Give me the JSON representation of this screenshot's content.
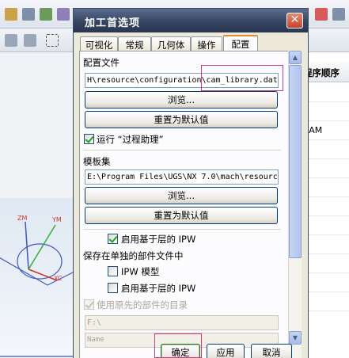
{
  "dialog": {
    "title": "加工首选项",
    "close_glyph": "✕",
    "tabs": [
      {
        "label": "可视化"
      },
      {
        "label": "常规"
      },
      {
        "label": "几何体"
      },
      {
        "label": "操作"
      },
      {
        "label": "配置",
        "active": true
      }
    ],
    "config_file": {
      "label": "配置文件",
      "value": "H\\resource\\configuration\\cam_library.dat",
      "browse_label": "浏览...",
      "reset_label": "重置为默认值"
    },
    "run_assistant": {
      "label": "运行 “过程助理”",
      "checked": true
    },
    "template_set": {
      "label": "模板集",
      "value": "E:\\Program Files\\UGS\\NX 7.0\\mach\\resourc",
      "browse_label": "浏览...",
      "reset_label": "重置为默认值"
    },
    "layer_ipw": {
      "label": "启用基于层的 IPW",
      "checked": true
    },
    "save_separate": {
      "label": "保存在单独的部件文件中"
    },
    "ipw_model": {
      "label": "IPW 模型",
      "checked": false
    },
    "layer_ipw2": {
      "label": "启用基于层的 IPW",
      "checked": false
    },
    "use_original_dir": {
      "label": "使用原先的部件的目录",
      "checked": true,
      "disabled": true
    },
    "dir_field": {
      "value": "F:\\"
    },
    "name_field": {
      "value": "Name"
    },
    "footer": {
      "ok_label": "确定",
      "apply_label": "应用",
      "cancel_label": "取消"
    },
    "scroll": {
      "up_glyph": "▲",
      "down_glyph": "▼"
    }
  },
  "background": {
    "right_header": "程序顺序",
    "right_row_text": "RAM",
    "axis_labels": [
      "ZM",
      "YM",
      "XC"
    ]
  },
  "colors": {
    "titlebar": "#33425f",
    "highlight": "#d03a86",
    "close_button": "#c8432a",
    "active_tab_accent": "#e68b2c"
  }
}
